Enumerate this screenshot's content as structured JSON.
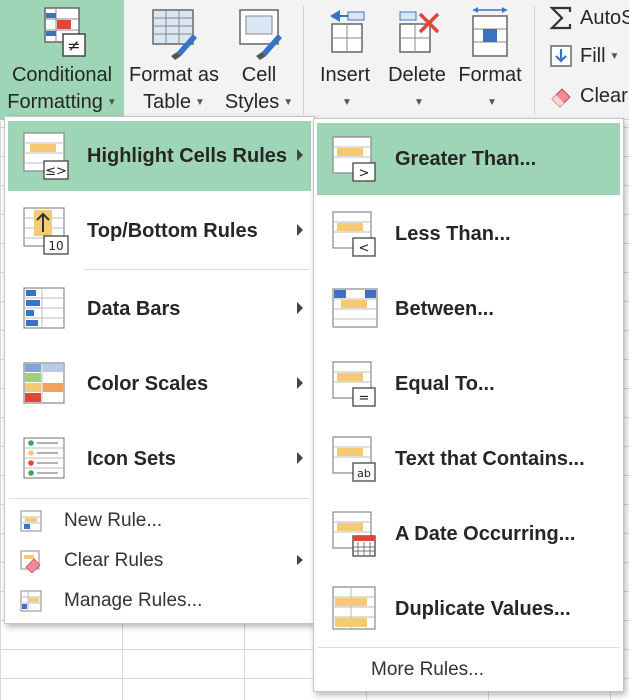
{
  "ribbon": {
    "conditional_formatting": {
      "line1": "Conditional",
      "line2": "Formatting"
    },
    "format_as_table": {
      "line1": "Format as",
      "line2": "Table"
    },
    "cell_styles": {
      "line1": "Cell",
      "line2": "Styles"
    },
    "insert": "Insert",
    "delete": "Delete",
    "format": "Format",
    "autosum": "AutoS",
    "fill": "Fill",
    "clear": "Clear"
  },
  "menu": {
    "items": [
      {
        "label": "Highlight Cells Rules",
        "icon": "highlight-cells-icon",
        "has_submenu": true,
        "highlighted": true
      },
      {
        "label": "Top/Bottom Rules",
        "icon": "top-bottom-icon",
        "has_submenu": true
      },
      {
        "label": "Data Bars",
        "icon": "data-bars-icon",
        "has_submenu": true
      },
      {
        "label": "Color Scales",
        "icon": "color-scales-icon",
        "has_submenu": true
      },
      {
        "label": "Icon Sets",
        "icon": "icon-sets-icon",
        "has_submenu": true
      }
    ],
    "small_items": [
      {
        "label": "New Rule...",
        "icon": "new-rule-icon"
      },
      {
        "label": "Clear Rules",
        "icon": "clear-rules-icon",
        "has_submenu": true
      },
      {
        "label": "Manage Rules...",
        "icon": "manage-rules-icon"
      }
    ]
  },
  "submenu": {
    "items": [
      {
        "label": "Greater Than...",
        "icon": "greater-than-icon",
        "highlighted": true
      },
      {
        "label": "Less Than...",
        "icon": "less-than-icon"
      },
      {
        "label": "Between...",
        "icon": "between-icon"
      },
      {
        "label": "Equal To...",
        "icon": "equal-to-icon"
      },
      {
        "label": "Text that Contains...",
        "icon": "text-contains-icon"
      },
      {
        "label": "A Date Occurring...",
        "icon": "date-occurring-icon"
      },
      {
        "label": "Duplicate Values...",
        "icon": "duplicate-values-icon"
      }
    ],
    "more_rules": "More Rules..."
  },
  "colors": {
    "highlight": "#9fd5b7",
    "ribbon_bg": "#f3f3f3",
    "rule_fill": "#f6c974",
    "data_bar_blue": "#3b73c4",
    "delete_red": "#e0473a"
  }
}
